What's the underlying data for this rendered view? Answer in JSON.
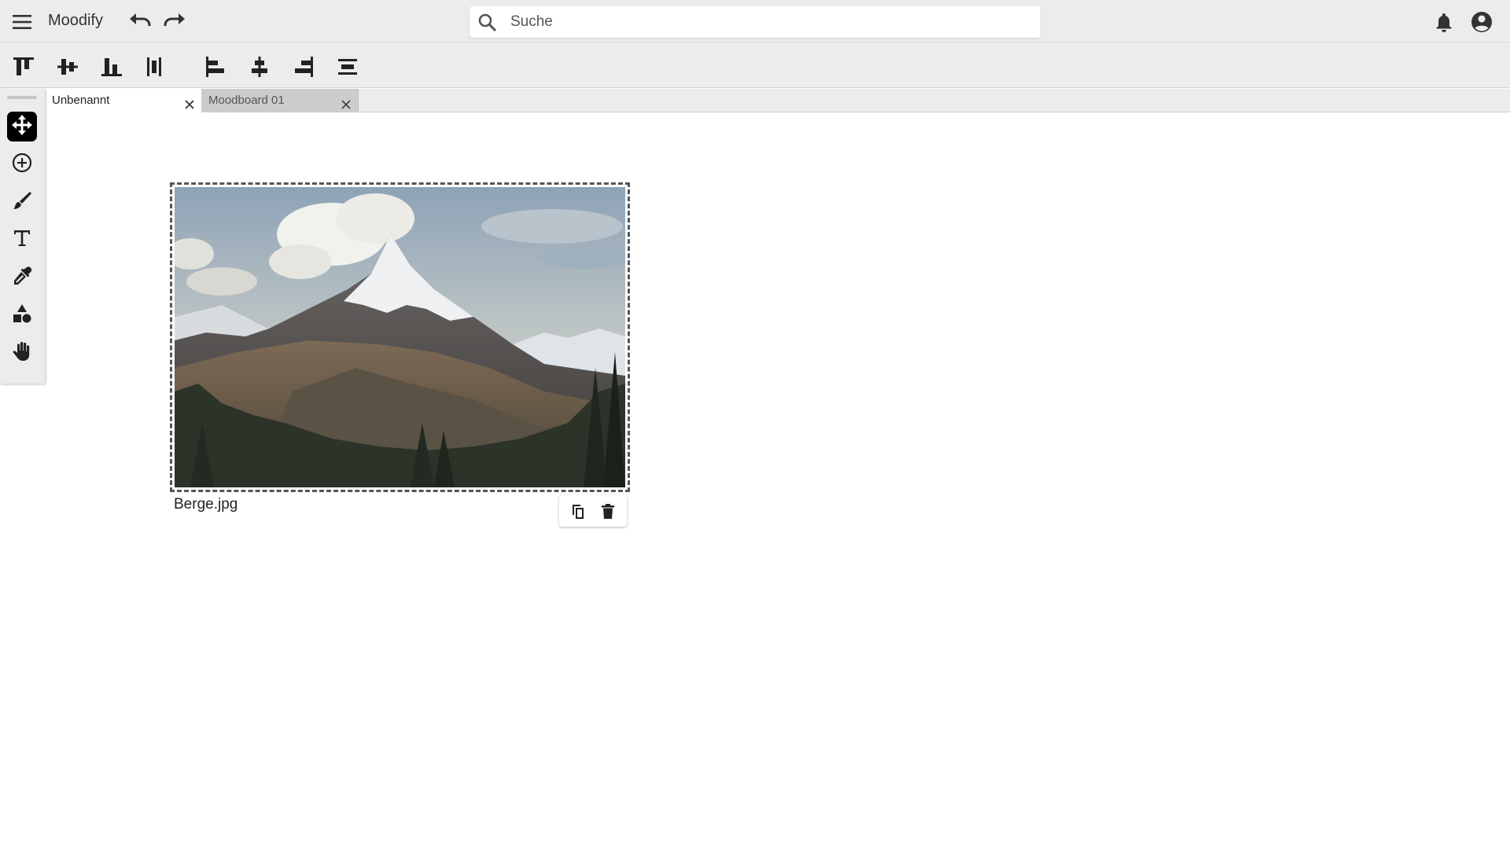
{
  "app": {
    "title": "Moodify"
  },
  "header": {
    "search_placeholder": "Suche",
    "search_value": "",
    "icons": [
      "menu-icon",
      "undo-icon",
      "redo-icon",
      "search-icon",
      "bell-icon",
      "account-circle-icon"
    ]
  },
  "align_toolbar": {
    "icons": [
      "align-top-icon",
      "align-vertical-center-icon",
      "align-bottom-icon",
      "distribute-vertical-icon",
      "align-left-icon",
      "align-horizontal-center-icon",
      "align-right-icon",
      "distribute-horizontal-icon"
    ]
  },
  "tabs": [
    {
      "label": "Unbenannt",
      "active": true
    },
    {
      "label": "Moodboard 01",
      "active": false
    }
  ],
  "tools": [
    {
      "icon": "move-icon",
      "active": true
    },
    {
      "icon": "add-circle-icon",
      "active": false
    },
    {
      "icon": "brush-icon",
      "active": false
    },
    {
      "icon": "text-icon",
      "active": false
    },
    {
      "icon": "eyedropper-icon",
      "active": false
    },
    {
      "icon": "shapes-icon",
      "active": false
    },
    {
      "icon": "hand-icon",
      "active": false
    }
  ],
  "canvas": {
    "image": {
      "caption": "Berge.jpg",
      "actions": [
        "copy-icon",
        "trash-icon"
      ]
    }
  },
  "colors": {
    "bar_bg": "#ececec",
    "active_tool_bg": "#000000",
    "inactive_tab_bg": "#cccccc",
    "selection_border": "#555555"
  }
}
